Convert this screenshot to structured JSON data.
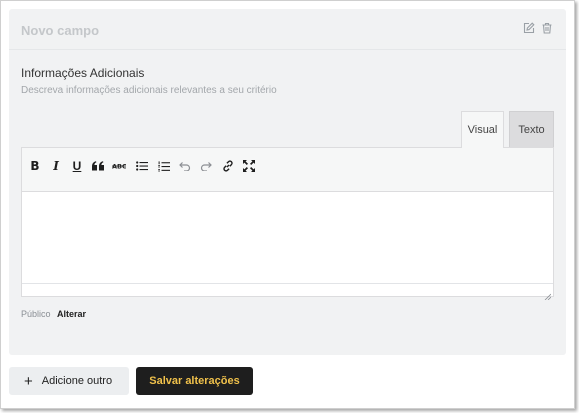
{
  "card": {
    "title": "Novo campo",
    "icons": [
      "edit-icon",
      "trash-icon"
    ]
  },
  "field": {
    "label": "Informações Adicionais",
    "description": "Descreva informações adicionais relevantes a seu critério"
  },
  "editor": {
    "tabs": [
      "Visual",
      "Texto"
    ],
    "active_tab": "Visual",
    "content": "",
    "toolbar": [
      "bold-icon",
      "italic-icon",
      "underline-icon",
      "blockquote-icon",
      "strikethrough-icon",
      "bullet-list-icon",
      "numbered-list-icon",
      "undo-icon",
      "redo-icon",
      "link-icon",
      "fullscreen-icon"
    ]
  },
  "visibility": {
    "label": "Público",
    "change_link": "Alterar"
  },
  "actions": {
    "add_another": "Adicione outro",
    "add_icon": "+",
    "save": "Salvar alterações"
  },
  "colors": {
    "save_bg": "#1e1e1e",
    "save_text": "#f0c14b",
    "card_bg": "#f1f2f3"
  }
}
